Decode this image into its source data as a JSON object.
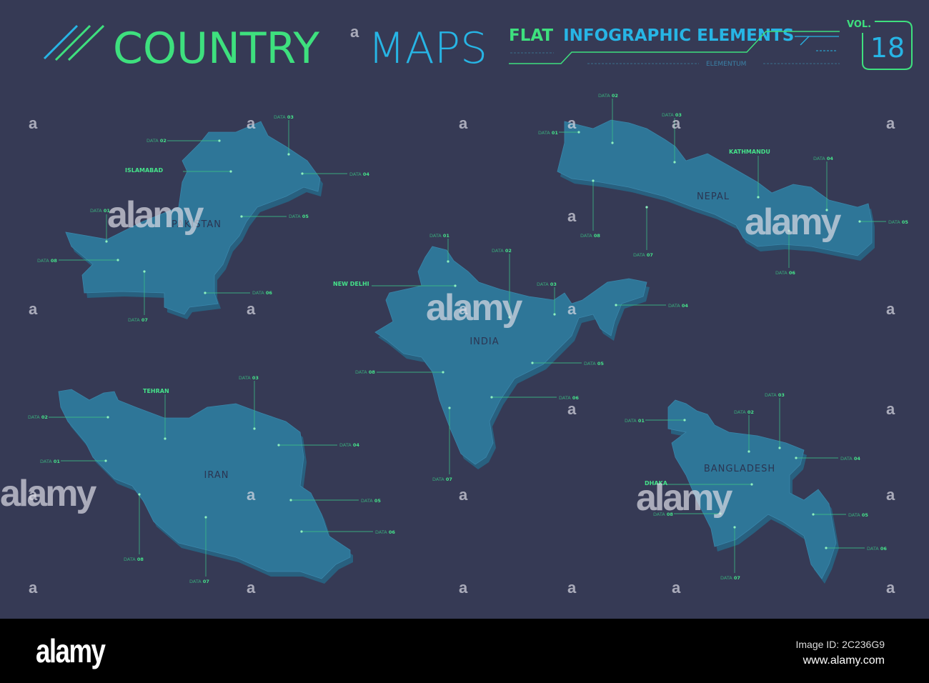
{
  "header": {
    "title_word1": "COUNTRY",
    "title_word2": "MAPS",
    "subtitle_part1": "FLAT",
    "subtitle_part2": "INFOGRAPHIC ELEMENTS",
    "brand": "ELEMENTUM",
    "vol_label": "VOL.",
    "vol_number": "18"
  },
  "colors": {
    "background": "#363a55",
    "map_fill": "#2e7698",
    "map_shadow": "#28607f",
    "green": "#3ee07e",
    "cyan": "#27b5e5"
  },
  "countries": [
    {
      "name": "PAKISTAN",
      "labels": [
        "ISLAMABAD",
        "DATA 01",
        "DATA 02",
        "DATA 03",
        "DATA 04",
        "DATA 05",
        "DATA 06",
        "DATA 07",
        "DATA 08"
      ]
    },
    {
      "name": "NEPAL",
      "labels": [
        "KATHMANDU",
        "DATA 01",
        "DATA 02",
        "DATA 03",
        "DATA 04",
        "DATA 05",
        "DATA 06",
        "DATA 07",
        "DATA 08"
      ]
    },
    {
      "name": "INDIA",
      "labels": [
        "NEW DELHI",
        "DATA 01",
        "DATA 02",
        "DATA 03",
        "DATA 04",
        "DATA 05",
        "DATA 06",
        "DATA 07",
        "DATA 08"
      ]
    },
    {
      "name": "IRAN",
      "labels": [
        "TEHRAN",
        "DATA 01",
        "DATA 02",
        "DATA 03",
        "DATA 04",
        "DATA 05",
        "DATA 06",
        "DATA 07",
        "DATA 08"
      ]
    },
    {
      "name": "BANGLADESH",
      "labels": [
        "DHAKA",
        "DATA 01",
        "DATA 02",
        "DATA 03",
        "DATA 04",
        "DATA 05",
        "DATA 06",
        "DATA 07",
        "DATA 08"
      ]
    }
  ],
  "watermark": {
    "logo": "alamy",
    "mark": "a"
  },
  "footer": {
    "logo": "alamy",
    "image_id": "Image ID: 2C236G9",
    "url": "www.alamy.com"
  }
}
